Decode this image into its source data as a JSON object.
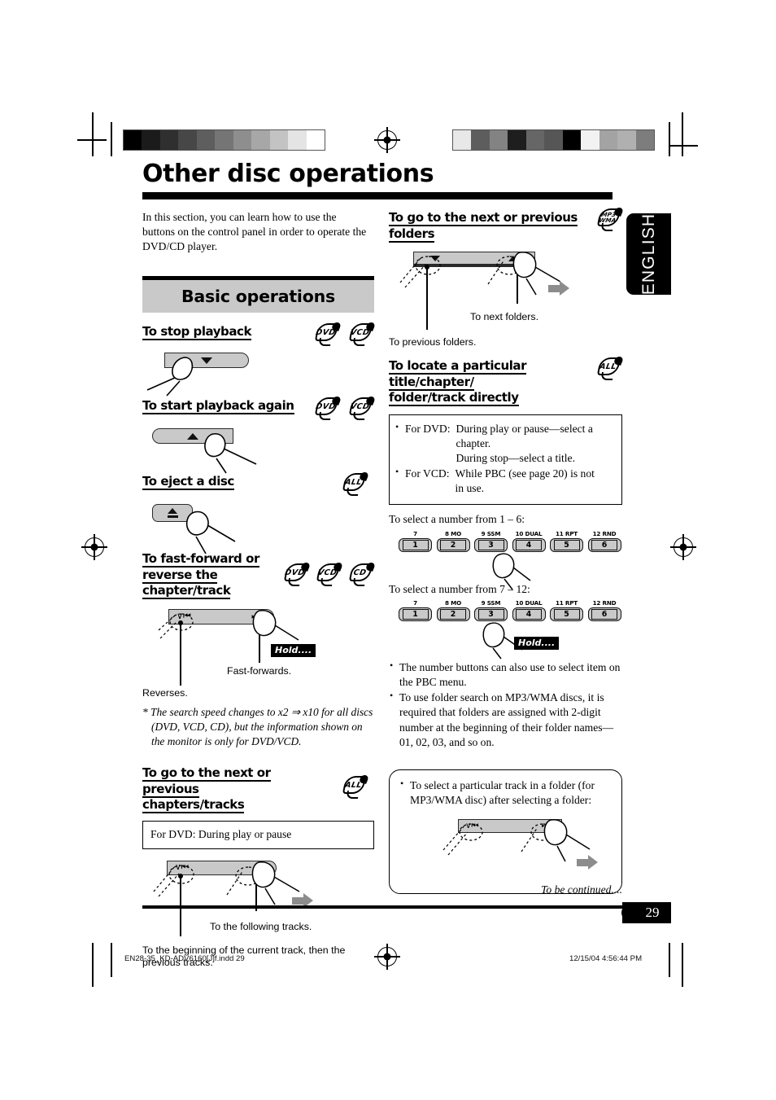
{
  "page": {
    "title": "Other disc operations",
    "intro": "In this section, you can learn how to use the buttons on the control panel in order to operate the DVD/CD player.",
    "language_tab": "ENGLISH",
    "section_heading": "Basic operations",
    "to_be_continued": "To be continued....",
    "page_number": "29"
  },
  "badges": {
    "dvd": "DVD",
    "vcd": "VCD",
    "cd": "CD",
    "all": "ALL",
    "mp3_line1": "MP3",
    "mp3_line2": "WMA"
  },
  "left": {
    "stop": {
      "heading": "To stop playback"
    },
    "start": {
      "heading": "To start playback again"
    },
    "eject": {
      "heading": "To eject a disc"
    },
    "ff": {
      "heading_l1": "To fast-forward or",
      "heading_l2": "reverse the chapter/track",
      "hold_label": "Hold....",
      "caption_ff": "Fast-forwards.",
      "caption_rev": "Reverses.",
      "note": "* The search speed changes to x2 ⇒ x10 for all discs (DVD, VCD, CD), but the information shown on the monitor is only for DVD/VCD."
    },
    "chapters": {
      "heading_l1": "To go to the next or previous",
      "heading_l2": "chapters/tracks",
      "boxed_note": "For DVD: During play or pause",
      "caption_next": "To the following tracks.",
      "caption_prev": "To the beginning of the current track, then the previous tracks."
    }
  },
  "right": {
    "folders": {
      "heading": "To go to the next or previous folders",
      "caption_next": "To next folders.",
      "caption_prev": "To previous folders."
    },
    "locate": {
      "heading_l1": "To locate a particular title/chapter/",
      "heading_l2": "folder/track directly",
      "notes": [
        {
          "label": "For DVD:",
          "lines": [
            "During play or pause—select a chapter.",
            "During stop—select a title."
          ]
        },
        {
          "label": "For VCD:",
          "lines": [
            "While PBC (see page 20) is not in use."
          ]
        }
      ],
      "select_1_6": "To select a number from 1 – 6:",
      "select_7_12": "To select a number from 7 – 12:",
      "hold_label": "Hold....",
      "bullets": [
        "The number buttons can also use to select item on the PBC menu.",
        "To use folder search on MP3/WMA discs, it is required that folders are assigned with 2-digit number at the beginning of their folder names—01, 02, 03, and so on."
      ],
      "roundbox_text": "To select a particular track in a folder (for MP3/WMA disc) after selecting a folder:"
    },
    "keypad": {
      "caps": [
        "7",
        "8 MO",
        "9 SSM",
        "10 DUAL",
        "11 RPT",
        "12 RND"
      ],
      "numbers": [
        "1",
        "2",
        "3",
        "4",
        "5",
        "6"
      ]
    }
  },
  "print_footer": {
    "filename": "EN28-35_KD-ADV6160[J]f.indd   29",
    "timestamp": "12/15/04   4:56:44 PM"
  },
  "colors": {
    "panel_gray": "#c9c9c9",
    "section_bar": "#c9c9c9",
    "ink": "#000000",
    "arrow_gray": "#8c8c8c"
  },
  "wedges": {
    "left": [
      "#000000",
      "#1b1b1b",
      "#2f2f2f",
      "#474747",
      "#5e5e5e",
      "#757575",
      "#8e8e8e",
      "#a7a7a7",
      "#c3c3c3",
      "#e4e4e4",
      "#ffffff"
    ],
    "right": [
      "#e8e8e8",
      "#5d5d5d",
      "#838383",
      "#1e1e1e",
      "#666666",
      "#565656",
      "#000000",
      "#f2f2f2",
      "#a3a3a3",
      "#b0b0b0",
      "#7d7d7d"
    ]
  }
}
